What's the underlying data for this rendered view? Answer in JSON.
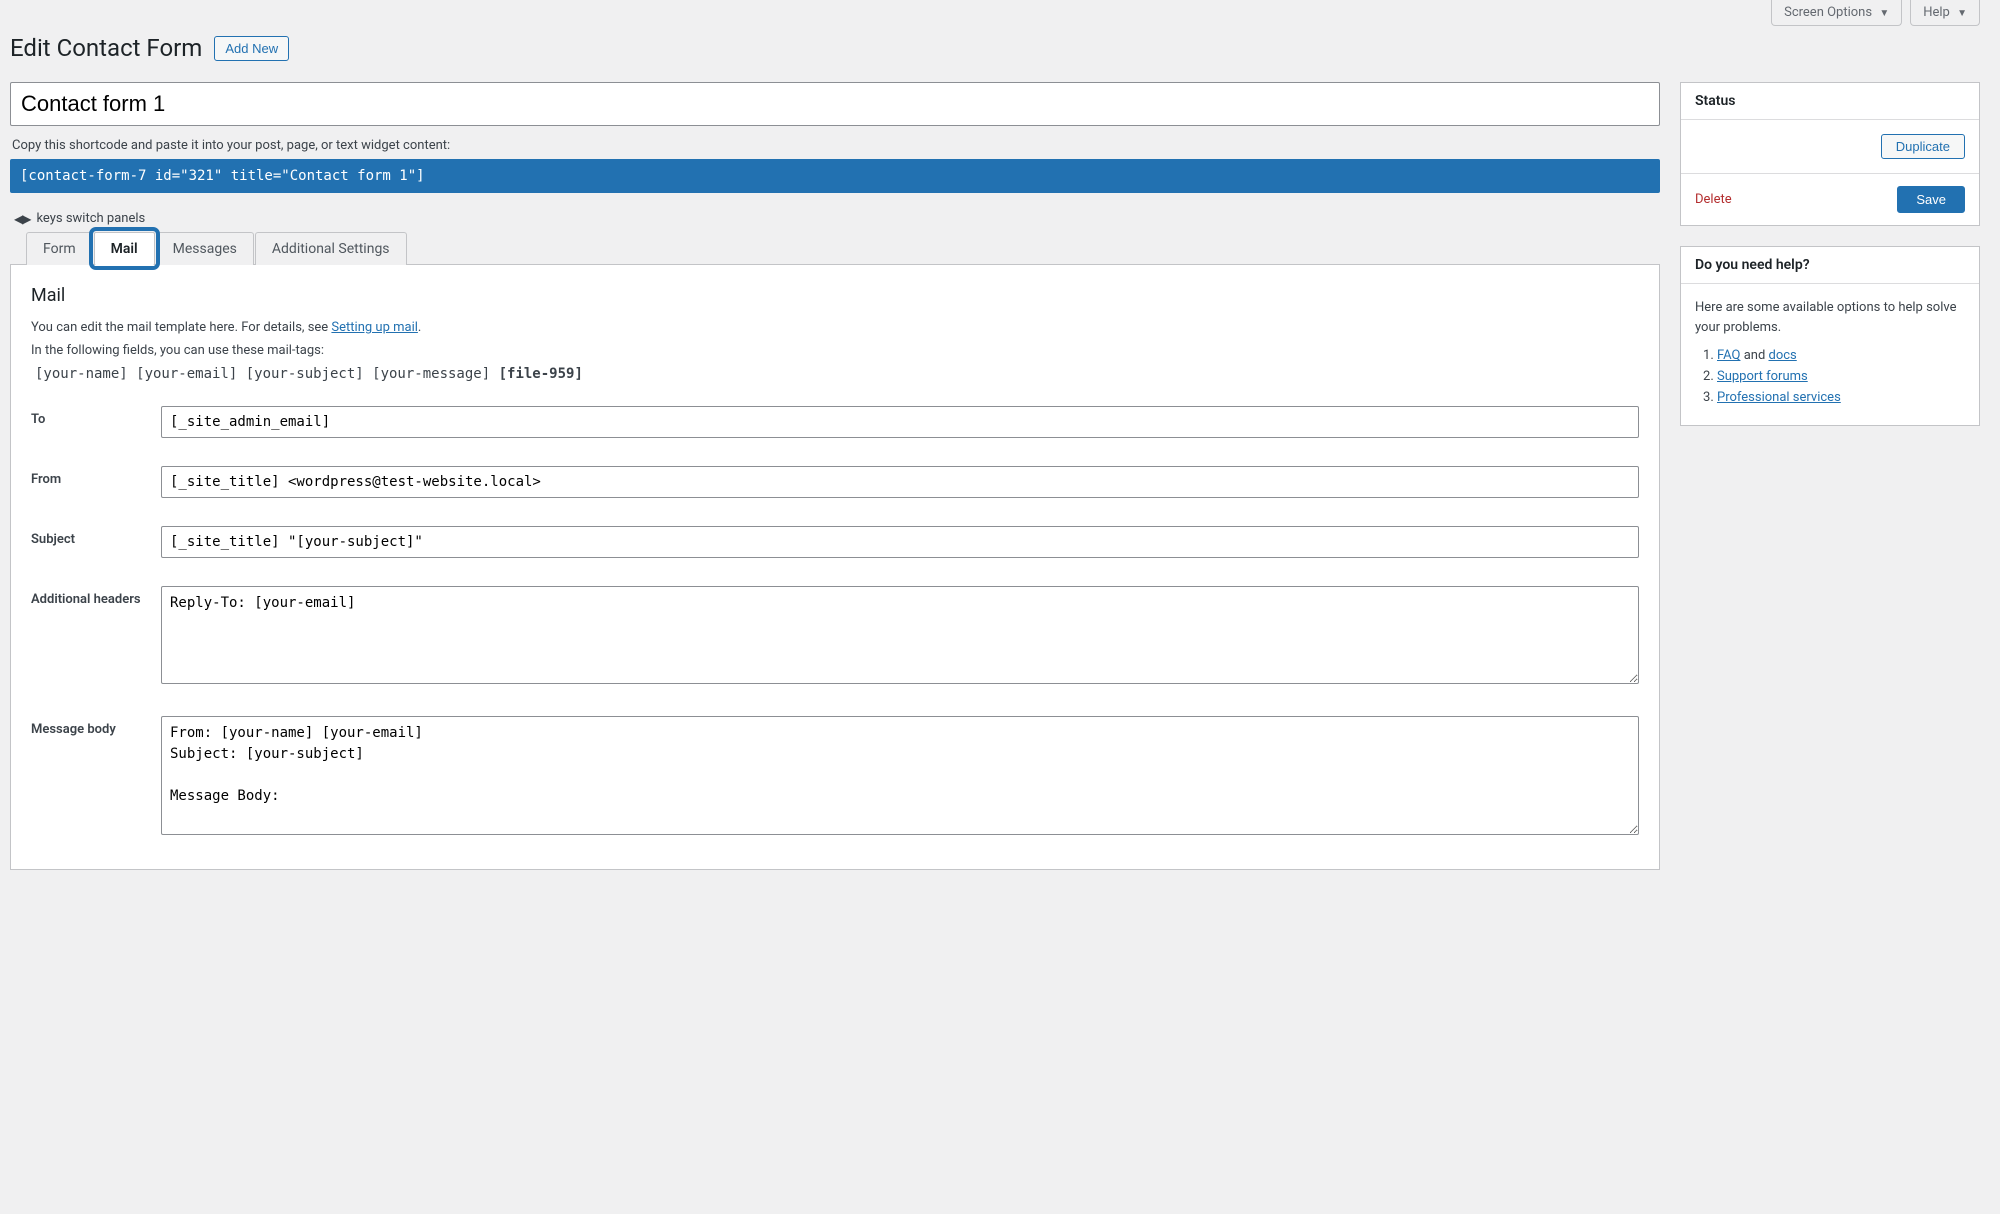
{
  "topbar": {
    "screen_options": "Screen Options",
    "help": "Help"
  },
  "header": {
    "page_title": "Edit Contact Form",
    "add_new": "Add New"
  },
  "form": {
    "title_value": "Contact form 1",
    "shortcode_label": "Copy this shortcode and paste it into your post, page, or text widget content:",
    "shortcode": "[contact-form-7 id=\"321\" title=\"Contact form 1\"]",
    "keys_hint": "keys switch panels"
  },
  "tabs": {
    "form": "Form",
    "mail": "Mail",
    "messages": "Messages",
    "additional": "Additional Settings",
    "active": "mail"
  },
  "mail": {
    "heading": "Mail",
    "desc_prefix": "You can edit the mail template here. For details, see ",
    "desc_link": "Setting up mail",
    "desc_suffix": ".",
    "tags_intro": "In the following fields, you can use these mail-tags:",
    "tags_normal": "[your-name] [your-email] [your-subject] [your-message]",
    "tags_bold": "[file-959]",
    "to_label": "To",
    "to_value": "[_site_admin_email]",
    "from_label": "From",
    "from_value": "[_site_title] <wordpress@test-website.local>",
    "subject_label": "Subject",
    "subject_value": "[_site_title] \"[your-subject]\"",
    "headers_label": "Additional headers",
    "headers_value": "Reply-To: [your-email]",
    "body_label": "Message body",
    "body_value": "From: [your-name] [your-email]\nSubject: [your-subject]\n\nMessage Body:"
  },
  "sidebar": {
    "status_heading": "Status",
    "duplicate": "Duplicate",
    "delete": "Delete",
    "save": "Save",
    "help_heading": "Do you need help?",
    "help_intro": "Here are some available options to help solve your problems.",
    "faq": "FAQ",
    "and": " and ",
    "docs": "docs",
    "support": "Support forums",
    "pro": "Professional services"
  }
}
